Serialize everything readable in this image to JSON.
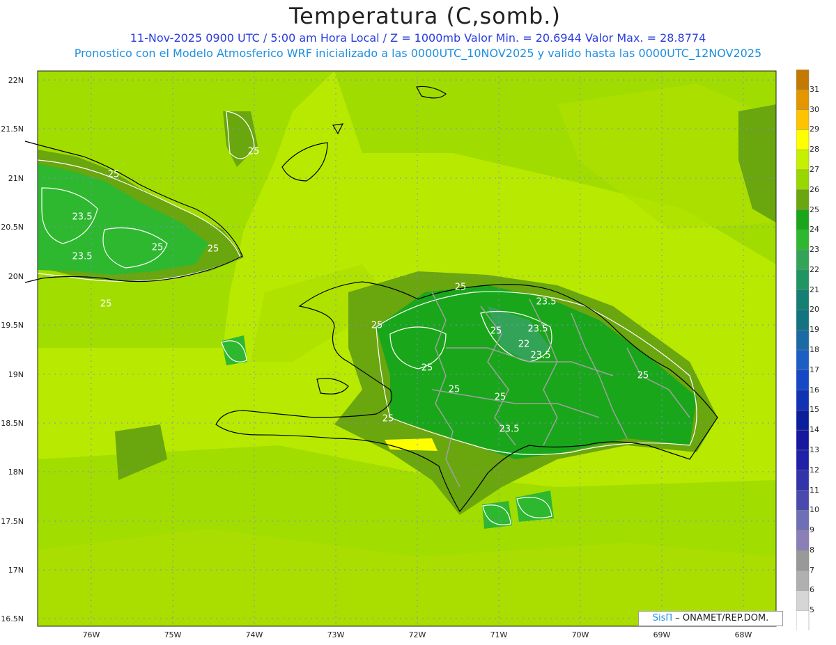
{
  "header": {
    "title": "Temperatura (C,somb.)",
    "line1": "11-Nov-2025  0900 UTC / 5:00 am Hora Local / Z = 1000mb   Valor Min. = 20.6944  Valor Max. = 28.8774",
    "line2": "Pronostico con el Modelo Atmosferico WRF inicializado a las 0000UTC_10NOV2025 y valido hasta las  0000UTC_12NOV2025"
  },
  "axes": {
    "lat_labels": [
      "22N",
      "21.5N",
      "21N",
      "20.5N",
      "20N",
      "19.5N",
      "19N",
      "18.5N",
      "18N",
      "17.5N",
      "17N",
      "16.5N"
    ],
    "lon_labels": [
      "76W",
      "75W",
      "74W",
      "73W",
      "72W",
      "71W",
      "70W",
      "69W",
      "68W"
    ]
  },
  "contour_labels": [
    "23.5",
    "23.5",
    "25",
    "25",
    "25",
    "25",
    "25",
    "25",
    "25",
    "23.5",
    "25",
    "23.5",
    "22",
    "23.5",
    "25",
    "25",
    "25",
    "23.5",
    "25",
    "25"
  ],
  "colorbar": {
    "labels": [
      "31",
      "30",
      "29",
      "28",
      "27",
      "26",
      "25",
      "24",
      "23",
      "22",
      "21",
      "20",
      "19",
      "18",
      "17",
      "16",
      "15",
      "14",
      "13",
      "12",
      "11",
      "10",
      "9",
      "8",
      "7",
      "6",
      "5"
    ],
    "colors": [
      "#c47a00",
      "#e39600",
      "#ffc300",
      "#ffff00",
      "#c5f000",
      "#99d700",
      "#6aa60e",
      "#1aa61a",
      "#2eb830",
      "#33a457",
      "#219464",
      "#157f73",
      "#147380",
      "#1b6aa4",
      "#1b5fc4",
      "#1647c4",
      "#0f33b4",
      "#0b1f9c",
      "#1717a0",
      "#2020a8",
      "#3333aa",
      "#4a4aae",
      "#6f6fb6",
      "#8c7fb6",
      "#999999",
      "#b0b0b0",
      "#d5d5d5",
      "#ffffff"
    ]
  },
  "credit": {
    "sis": "SisΠ",
    "org": " – ONAMET/REP.DOM."
  }
}
